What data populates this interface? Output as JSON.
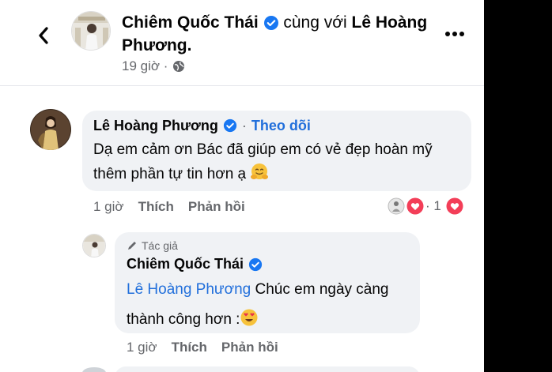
{
  "header": {
    "author": "Chiêm Quốc Thái",
    "with_text": "cùng với",
    "tagged_line1": "Lê Hoàng",
    "tagged_line2": "Phương.",
    "time": "19 giờ ·",
    "privacy_icon": "globe-icon"
  },
  "comment": {
    "author": "Lê Hoàng Phương",
    "follow_label": "Theo dõi",
    "separator": "·",
    "text": "Dạ em cảm ơn Bác đã giúp em có vẻ đẹp hoàn mỹ thêm phần tự tin hơn ạ",
    "emoji": "hugging-face",
    "time": "1 giờ",
    "like_label": "Thích",
    "reply_label": "Phản hồi",
    "reaction_count": "· 1",
    "reaction_icon": "heart-icon"
  },
  "reply": {
    "author_tag": "Tác giả",
    "author": "Chiêm Quốc Thái",
    "mention": "Lê Hoàng Phương",
    "text_line1": "Chúc em ngày càng",
    "text_line2": "thành công hơn :",
    "emoji": "heart-eyes",
    "time": "1 giờ",
    "like_label": "Thích",
    "reply_label": "Phản hồi"
  },
  "colors": {
    "link_blue": "#216fdb",
    "bubble": "#f0f2f5",
    "meta_gray": "#65676b",
    "verified_blue": "#1877f2",
    "heart_red": "#f33e58"
  }
}
